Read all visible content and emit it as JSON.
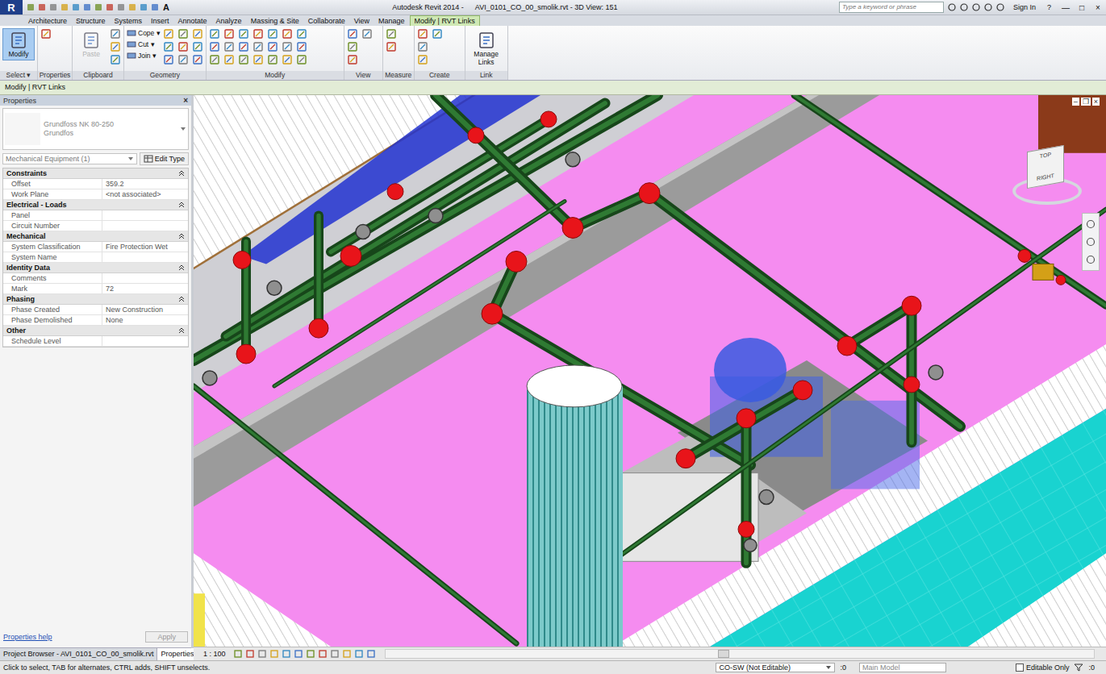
{
  "app": {
    "logo": "R",
    "title": "Autodesk Revit 2014 -",
    "file": "AVI_0101_CO_00_smolik.rvt - 3D View: 151"
  },
  "quick_access": {
    "text_icon": "A"
  },
  "search": {
    "placeholder": "Type a keyword or phrase"
  },
  "sign_in": "Sign In",
  "help": "?",
  "window_controls": [
    "—",
    "□",
    "×"
  ],
  "ribbon_tabs": [
    {
      "label": "Architecture",
      "selected": false
    },
    {
      "label": "Structure",
      "selected": false
    },
    {
      "label": "Systems",
      "selected": false
    },
    {
      "label": "Insert",
      "selected": false
    },
    {
      "label": "Annotate",
      "selected": false
    },
    {
      "label": "Analyze",
      "selected": false
    },
    {
      "label": "Massing & Site",
      "selected": false
    },
    {
      "label": "Collaborate",
      "selected": false
    },
    {
      "label": "View",
      "selected": false
    },
    {
      "label": "Manage",
      "selected": false
    },
    {
      "label": "Modify | RVT Links",
      "selected": true
    }
  ],
  "ribbon_groups": [
    {
      "label": "Select ▾",
      "buttons": [
        {
          "label": "Modify",
          "kind": "large",
          "selected": true,
          "disabled": false
        }
      ]
    },
    {
      "label": "Properties",
      "buttons": []
    },
    {
      "label": "Clipboard",
      "buttons": [
        {
          "label": "Paste",
          "kind": "large",
          "selected": false,
          "disabled": true
        }
      ]
    },
    {
      "label": "Geometry",
      "buttons": [
        {
          "label": "Cope ▾",
          "kind": "small",
          "selected": false,
          "disabled": false
        },
        {
          "label": "Cut ▾",
          "kind": "small",
          "selected": false,
          "disabled": false
        },
        {
          "label": "Join ▾",
          "kind": "small",
          "selected": false,
          "disabled": false
        }
      ]
    },
    {
      "label": "Modify",
      "buttons": []
    },
    {
      "label": "View",
      "buttons": []
    },
    {
      "label": "Measure",
      "buttons": []
    },
    {
      "label": "Create",
      "buttons": []
    },
    {
      "label": "Link",
      "buttons": [
        {
          "label": "Manage Links",
          "kind": "large",
          "selected": false,
          "disabled": false
        }
      ]
    }
  ],
  "options_bar": "Modify | RVT Links",
  "properties": {
    "title": "Properties",
    "close": "×",
    "type_name": "Grundfoss NK 80-250",
    "type_family": "Grundfos",
    "category": "Mechanical Equipment (1)",
    "edit_type": "Edit Type",
    "sections": [
      {
        "name": "Constraints",
        "rows": [
          {
            "label": "Offset",
            "value": "359.2"
          },
          {
            "label": "Work Plane",
            "value": "<not associated>"
          }
        ]
      },
      {
        "name": "Electrical - Loads",
        "rows": [
          {
            "label": "Panel",
            "value": ""
          },
          {
            "label": "Circuit Number",
            "value": ""
          }
        ]
      },
      {
        "name": "Mechanical",
        "rows": [
          {
            "label": "System Classification",
            "value": "Fire Protection Wet"
          },
          {
            "label": "System Name",
            "value": ""
          }
        ]
      },
      {
        "name": "Identity Data",
        "rows": [
          {
            "label": "Comments",
            "value": ""
          },
          {
            "label": "Mark",
            "value": "72"
          }
        ]
      },
      {
        "name": "Phasing",
        "rows": [
          {
            "label": "Phase Created",
            "value": "New Construction"
          },
          {
            "label": "Phase Demolished",
            "value": "None"
          }
        ]
      },
      {
        "name": "Other",
        "rows": [
          {
            "label": "Schedule Level",
            "value": ""
          }
        ]
      }
    ],
    "help": "Properties help",
    "apply": {
      "label": "Apply",
      "disabled": true
    }
  },
  "bottom_tabs": [
    {
      "label": "Project Browser - AVI_0101_CO_00_smolik.rvt",
      "selected": false
    },
    {
      "label": "Properties",
      "selected": true
    }
  ],
  "view": {
    "scale": "1 : 100",
    "viewcube": {
      "top": "TOP",
      "right": "RIGHT"
    },
    "window_controls": [
      "–",
      "❐",
      "×"
    ]
  },
  "status_bar": {
    "hint": "Click to select, TAB for alternates, CTRL adds, SHIFT unselects.",
    "workset": "CO-SW (Not Editable)",
    "workset_count": ":0",
    "design_option": "Main Model",
    "editable_only": {
      "label": "Editable Only",
      "checked": false
    },
    "filter_count": ":0"
  }
}
